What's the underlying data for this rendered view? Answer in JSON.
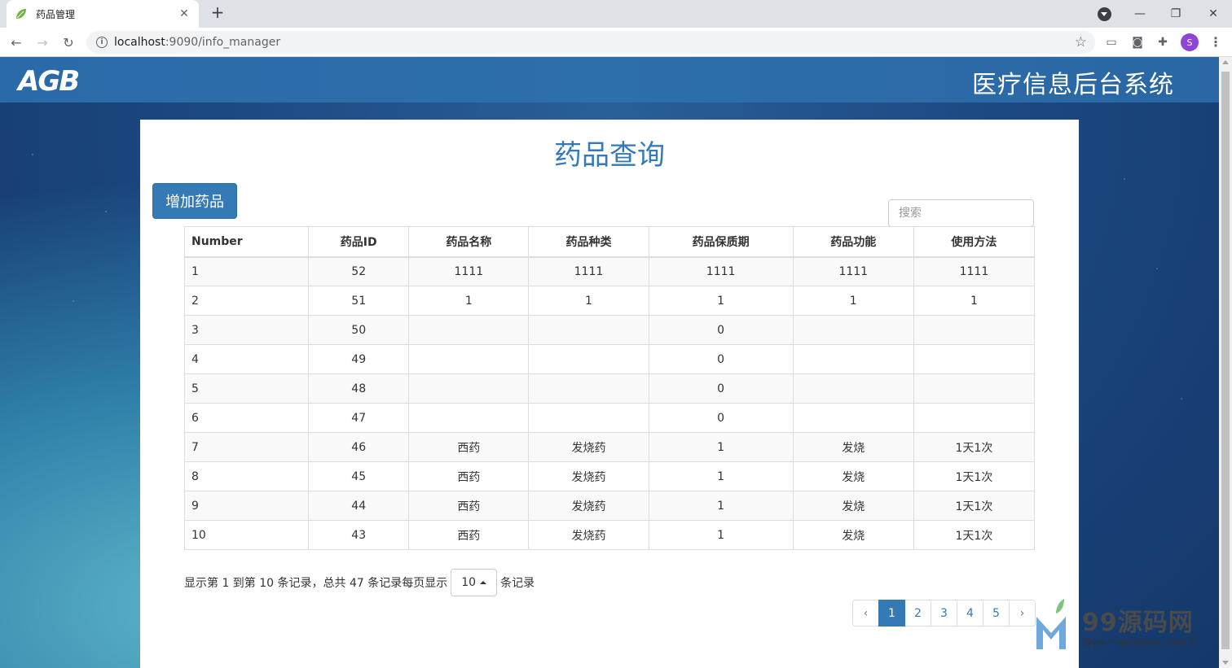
{
  "browser": {
    "tab_title": "药品管理",
    "new_tab": "+",
    "url_host": "localhost",
    "url_path": ":9090/info_manager",
    "avatar_letter": "S"
  },
  "header": {
    "logo": "AGB",
    "system_title": "医疗信息后台系统"
  },
  "panel": {
    "title": "药品查询",
    "add_button": "增加药品",
    "search_placeholder": "搜索"
  },
  "table": {
    "columns": [
      "Number",
      "药品ID",
      "药品名称",
      "药品种类",
      "药品保质期",
      "药品功能",
      "使用方法"
    ],
    "rows": [
      [
        "1",
        "52",
        "1111",
        "1111",
        "1111",
        "1111",
        "1111"
      ],
      [
        "2",
        "51",
        "1",
        "1",
        "1",
        "1",
        "1"
      ],
      [
        "3",
        "50",
        "",
        "",
        "0",
        "",
        ""
      ],
      [
        "4",
        "49",
        "",
        "",
        "0",
        "",
        ""
      ],
      [
        "5",
        "48",
        "",
        "",
        "0",
        "",
        ""
      ],
      [
        "6",
        "47",
        "",
        "",
        "0",
        "",
        ""
      ],
      [
        "7",
        "46",
        "西药",
        "发烧药",
        "1",
        "发烧",
        "1天1次"
      ],
      [
        "8",
        "45",
        "西药",
        "发烧药",
        "1",
        "发烧",
        "1天1次"
      ],
      [
        "9",
        "44",
        "西药",
        "发烧药",
        "1",
        "发烧",
        "1天1次"
      ],
      [
        "10",
        "43",
        "西药",
        "发烧药",
        "1",
        "发烧",
        "1天1次"
      ]
    ]
  },
  "pager": {
    "info_text": "显示第 1 到第 10 条记录，总共 47 条记录每页显示",
    "page_size": "10",
    "suffix": "条记录",
    "prev": "‹",
    "next": "›",
    "pages": [
      "1",
      "2",
      "3",
      "4",
      "5"
    ],
    "active_page": "1"
  },
  "watermark": {
    "title": "99源码网",
    "subtitle": "@yw.maptorace.com 区"
  },
  "colors": {
    "primary": "#337ab7",
    "header_band": "#2b6aa8"
  }
}
